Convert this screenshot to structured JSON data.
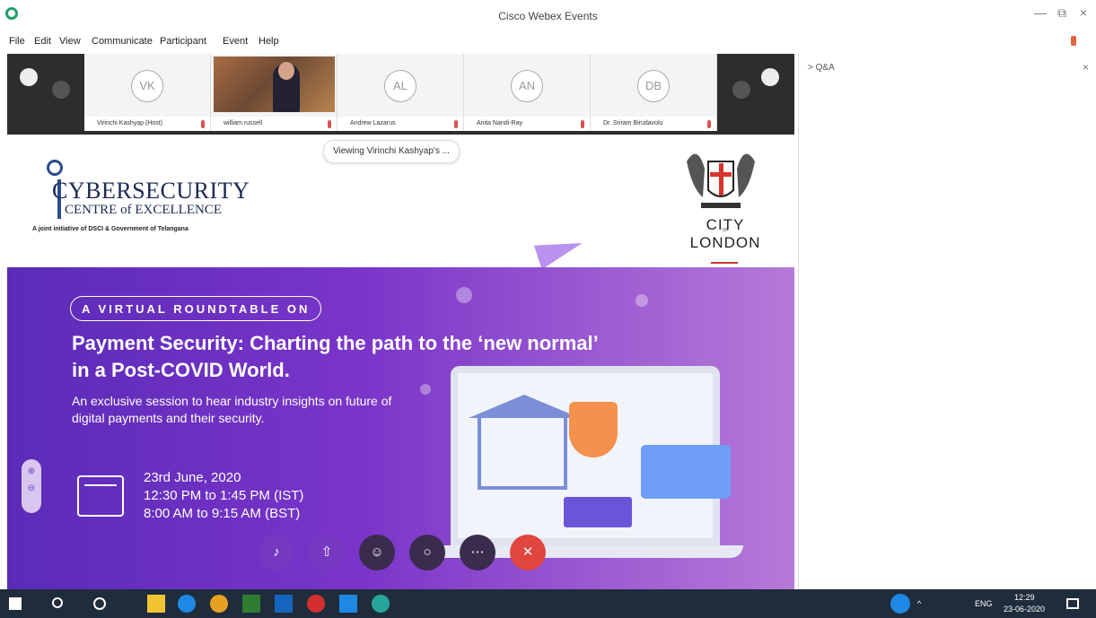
{
  "window": {
    "title": "Cisco Webex Events",
    "minimize": "—",
    "restore": "⧉",
    "close": "×"
  },
  "menu": [
    {
      "label": "File"
    },
    {
      "label": "Edit"
    },
    {
      "label": "View"
    },
    {
      "label": "Communicate"
    },
    {
      "label": "Participant"
    },
    {
      "label": "Event"
    },
    {
      "label": "Help"
    }
  ],
  "participants": [
    {
      "initials": "VK",
      "name": "Virinchi Kashyap (Host)"
    },
    {
      "initials": "",
      "name": "william russell"
    },
    {
      "initials": "AL",
      "name": "Andrew Lazarus"
    },
    {
      "initials": "AN",
      "name": "Anita Nandi-Ray"
    },
    {
      "initials": "DB",
      "name": "Dr. Sriram Birudavolu"
    }
  ],
  "viewing_label": "Viewing Virinchi Kashyap's ...",
  "slide": {
    "coe_title": "CYBERSECURITY",
    "coe_sub": "CENTRE of EXCELLENCE",
    "coe_tagline": "A joint initiative of DSCI & Government of Telangana",
    "city_name_1": "CITY",
    "city_of": "OF",
    "city_name_2": "LONDON",
    "pill": "A VIRTUAL ROUNDTABLE ON",
    "headline_1": "Payment Security: Charting the path to the ‘new normal’",
    "headline_2": "in a Post-COVID World.",
    "desc": "An exclusive session to hear industry insights on future of digital payments and their security.",
    "date": "23rd June, 2020",
    "time_ist": "12:30 PM to 1:45 PM (IST)",
    "time_bst": "8:00 AM to 9:15 AM (BST)"
  },
  "qa": {
    "title": "> Q&A",
    "close": "×"
  },
  "taskbar": {
    "lang": "ENG",
    "time": "12:29",
    "date": "23-06-2020"
  },
  "colors": {
    "accent_purple": "#7a35c9",
    "end_red": "#e0453f",
    "taskbar": "#1f2c3b"
  }
}
